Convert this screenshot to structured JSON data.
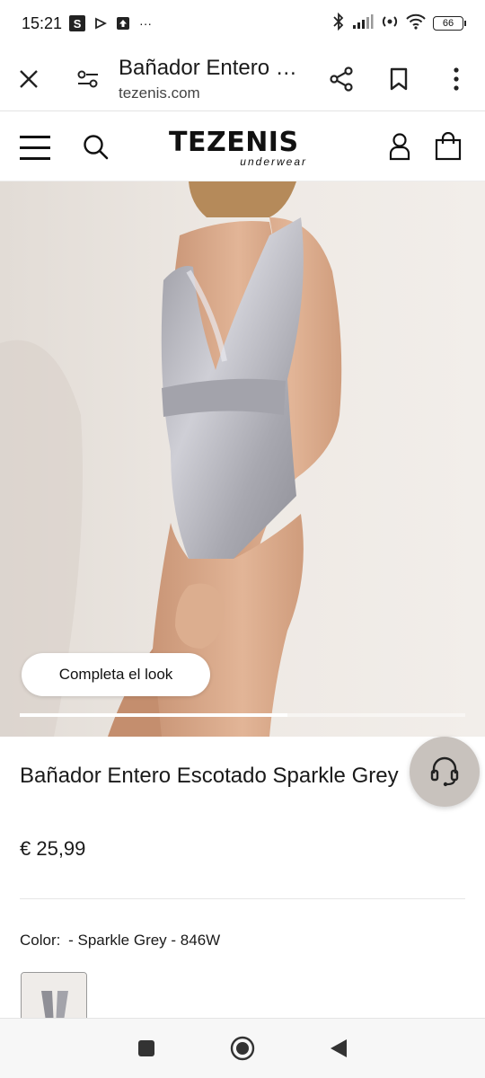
{
  "status_bar": {
    "time": "15:21",
    "s_badge": "S",
    "more": "···",
    "battery": "66"
  },
  "browser": {
    "title": "Bañador Entero …",
    "url": "tezenis.com"
  },
  "site": {
    "logo_main": "TEZENIS",
    "logo_sub": "underwear"
  },
  "hero": {
    "complete_look_label": "Completa el look",
    "carousel_progress": 0.6
  },
  "product": {
    "title": "Bañador Entero Escotado Sparkle Grey",
    "price": "€ 25,99",
    "color_label": "Color:",
    "color_value": "- Sparkle Grey - 846W"
  },
  "colors": {
    "background": "#ffffff",
    "text": "#1a1a1a",
    "hero_bg": "#ece7e2",
    "support_button": "#c8c2bd",
    "divider": "#e6e6e6"
  },
  "icons": {
    "close": "close-icon",
    "tune": "page-settings-icon",
    "share": "share-icon",
    "bookmark": "bookmark-icon",
    "menu": "more-vert-icon",
    "hamburger": "hamburger-menu-icon",
    "search": "search-icon",
    "account": "user-icon",
    "bag": "shopping-bag-icon",
    "support": "headset-icon",
    "nav_recent": "square-icon",
    "nav_home": "circle-icon",
    "nav_back": "triangle-back-icon"
  }
}
